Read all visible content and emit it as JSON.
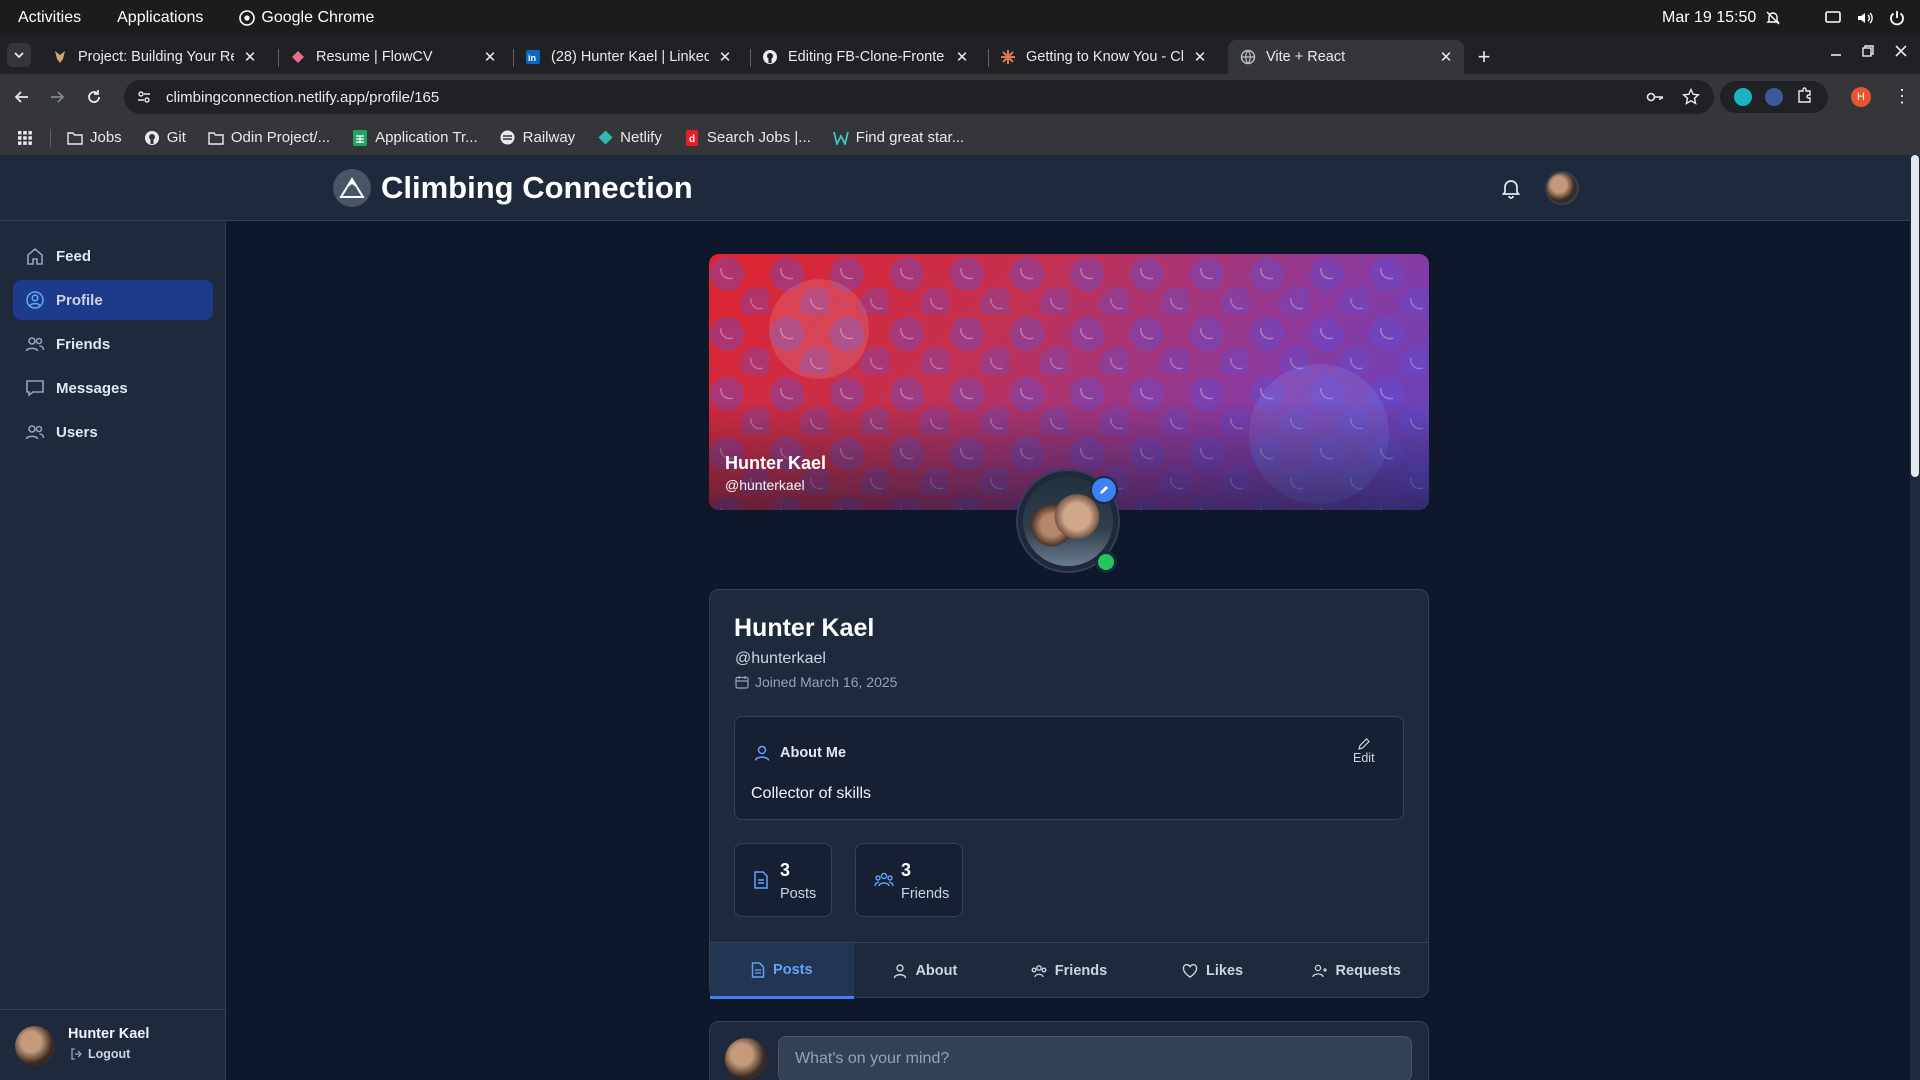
{
  "os": {
    "activities": "Activities",
    "applications": "Applications",
    "app_name": "Google Chrome",
    "datetime": "Mar 19  15:50"
  },
  "browser": {
    "tabs": [
      {
        "title": "Project: Building Your Re",
        "icon": "odin-icon"
      },
      {
        "title": "Resume | FlowCV",
        "icon": "flowcv-icon"
      },
      {
        "title": "(28) Hunter Kael | Linked",
        "icon": "linkedin-icon"
      },
      {
        "title": "Editing FB-Clone-Fronte",
        "icon": "github-icon"
      },
      {
        "title": "Getting to Know You - Cl",
        "icon": "claude-icon"
      },
      {
        "title": "Vite + React",
        "icon": "globe-icon"
      }
    ],
    "url": "climbingconnection.netlify.app/profile/165",
    "profile_initial": "H",
    "bookmarks": [
      {
        "label": "Jobs",
        "icon": "folder-icon"
      },
      {
        "label": "Git",
        "icon": "github-icon"
      },
      {
        "label": "Odin Project/...",
        "icon": "folder-icon"
      },
      {
        "label": "Application Tr...",
        "icon": "sheets-icon"
      },
      {
        "label": "Railway",
        "icon": "railway-icon"
      },
      {
        "label": "Netlify",
        "icon": "netlify-icon"
      },
      {
        "label": "Search Jobs |...",
        "icon": "dice-icon"
      },
      {
        "label": "Find great star...",
        "icon": "wellfound-icon"
      }
    ]
  },
  "app": {
    "title": "Climbing Connection",
    "nav": [
      {
        "label": "Feed",
        "icon": "home-icon"
      },
      {
        "label": "Profile",
        "icon": "user-circle-icon"
      },
      {
        "label": "Friends",
        "icon": "users-icon"
      },
      {
        "label": "Messages",
        "icon": "message-icon"
      },
      {
        "label": "Users",
        "icon": "users-icon"
      }
    ],
    "active_nav": "Profile",
    "footer": {
      "name": "Hunter Kael",
      "logout": "Logout"
    }
  },
  "profile": {
    "cover_name": "Hunter Kael",
    "cover_handle": "@hunterkael",
    "name": "Hunter Kael",
    "handle": "@hunterkael",
    "joined": "Joined March 16, 2025",
    "about_title": "About Me",
    "about_edit": "Edit",
    "about_text": "Collector of skills",
    "stats": [
      {
        "value": "3",
        "label": "Posts",
        "icon": "document-icon"
      },
      {
        "value": "3",
        "label": "Friends",
        "icon": "users-icon"
      }
    ],
    "tabs": [
      {
        "label": "Posts",
        "icon": "document-icon"
      },
      {
        "label": "About",
        "icon": "user-icon"
      },
      {
        "label": "Friends",
        "icon": "users-icon"
      },
      {
        "label": "Likes",
        "icon": "heart-icon"
      },
      {
        "label": "Requests",
        "icon": "user-plus-icon"
      }
    ],
    "active_tab": "Posts",
    "composer_placeholder": "What's on your mind?"
  },
  "colors": {
    "accent": "#3b82f6",
    "background": "#0f172a",
    "surface": "#1e293b",
    "online": "#22c55e"
  }
}
